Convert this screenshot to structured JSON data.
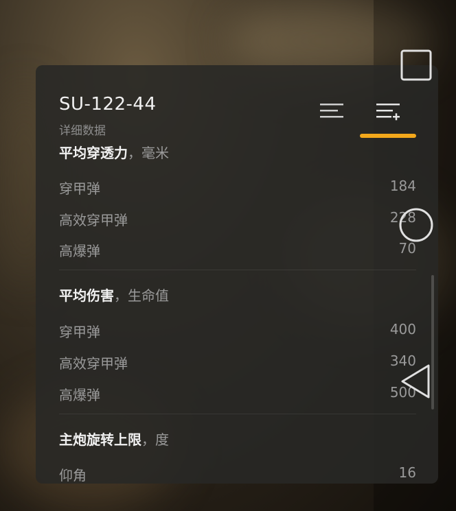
{
  "header": {
    "title": "SU-122-44",
    "subtitle": "详细数据"
  },
  "tabs": [
    {
      "icon": "list-icon",
      "active": false
    },
    {
      "icon": "list-plus-icon",
      "active": true
    }
  ],
  "accent_color": "#f3a81b",
  "sections": [
    {
      "title": "平均穿透力",
      "unit": "，毫米",
      "rows": [
        {
          "label": "穿甲弹",
          "value": "184"
        },
        {
          "label": "高效穿甲弹",
          "value": "228"
        },
        {
          "label": "高爆弹",
          "value": "70"
        }
      ]
    },
    {
      "title": "平均伤害",
      "unit": "，生命值",
      "rows": [
        {
          "label": "穿甲弹",
          "value": "400"
        },
        {
          "label": "高效穿甲弹",
          "value": "340"
        },
        {
          "label": "高爆弹",
          "value": "500"
        }
      ]
    },
    {
      "title": "主炮旋转上限",
      "unit": "，度",
      "rows": [
        {
          "label": "仰角",
          "value": "16"
        }
      ]
    }
  ],
  "system_nav": {
    "recent": "square-icon",
    "home": "circle-icon",
    "back": "triangle-icon"
  }
}
